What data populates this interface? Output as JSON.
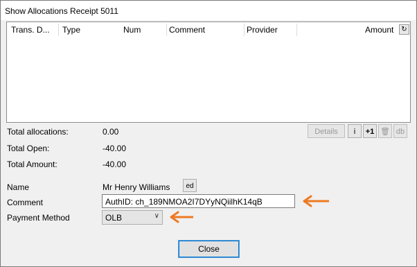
{
  "window": {
    "title": "Show Allocations Receipt 5011"
  },
  "grid": {
    "columns": [
      "Trans. D...",
      "Type",
      "Num",
      "Comment",
      "Provider",
      "Amount"
    ],
    "refresh_icon": "refresh-icon"
  },
  "summary": {
    "total_allocations_label": "Total allocations:",
    "total_allocations_value": "0.00",
    "total_open_label": "Total Open:",
    "total_open_value": "-40.00",
    "total_amount_label": "Total Amount:",
    "total_amount_value": "-40.00"
  },
  "toolbar": {
    "details_label": "Details",
    "info_label": "i",
    "plus_one_label": "+1",
    "delete_icon": "trash-icon",
    "db_label": "db"
  },
  "form": {
    "name_label": "Name",
    "name_value": "Mr Henry Williams",
    "edit_button_label": "ed",
    "comment_label": "Comment",
    "comment_value": "AuthID: ch_189NMOA2I7DYyNQiilhK14qB",
    "payment_method_label": "Payment Method",
    "payment_method_value": "OLB"
  },
  "footer": {
    "close_label": "Close"
  },
  "colors": {
    "annotation_arrow": "#ee7a22",
    "focus_border": "#0078d7"
  }
}
